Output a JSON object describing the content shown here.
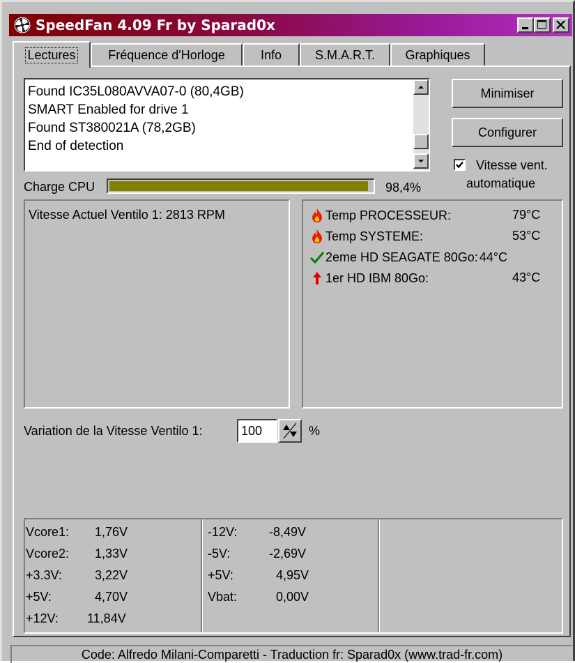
{
  "window": {
    "title": "SpeedFan 4.09 Fr by Sparad0x",
    "minimize_icon": "minimize-icon",
    "maximize_icon": "maximize-icon",
    "close_icon": "close-icon"
  },
  "tabs": [
    {
      "label": "Lectures",
      "active": true
    },
    {
      "label": "Fréquence d'Horloge"
    },
    {
      "label": "Info"
    },
    {
      "label": "S.M.A.R.T."
    },
    {
      "label": "Graphiques"
    }
  ],
  "log": {
    "lines": [
      "Found IC35L080AVVA07-0 (80,4GB)",
      "SMART Enabled for drive 1",
      "Found ST380021A (78,2GB)",
      "End of detection"
    ]
  },
  "buttons": {
    "minimize": "Minimiser",
    "configure": "Configurer"
  },
  "auto_fan": {
    "label_line1": "Vitesse vent.",
    "label_line2": "automatique",
    "checked": true
  },
  "cpu": {
    "label": "Charge CPU",
    "percent_text": "98,4%",
    "load_fraction": 0.984,
    "bar_color": "#808000"
  },
  "fans": {
    "lines": [
      "Vitesse Actuel Ventilo 1: 2813 RPM"
    ]
  },
  "temps": [
    {
      "icon": "flame-icon",
      "label": "Temp PROCESSEUR:",
      "value": "79°C"
    },
    {
      "icon": "flame-icon",
      "label": "Temp SYSTEME:",
      "value": "53°C"
    },
    {
      "icon": "checkmark-icon",
      "label": "2eme HD SEAGATE 80Go:",
      "value": "44°C"
    },
    {
      "icon": "arrow-up-icon",
      "label": "1er HD IBM 80Go:",
      "value": "43°C"
    }
  ],
  "fan_variation": {
    "label": "Variation de la Vitesse Ventilo 1:",
    "value": "100",
    "unit": "%"
  },
  "voltages": {
    "col1": [
      {
        "label": "Vcore1:",
        "value": "1,76V"
      },
      {
        "label": "Vcore2:",
        "value": "1,33V"
      },
      {
        "label": "+3.3V:",
        "value": "3,22V"
      },
      {
        "label": "+5V:",
        "value": "4,70V"
      },
      {
        "label": "+12V:",
        "value": "11,84V"
      }
    ],
    "col2": [
      {
        "label": "-12V:",
        "value": "-8,49V"
      },
      {
        "label": "-5V:",
        "value": "-2,69V"
      },
      {
        "label": "+5V:",
        "value": "4,95V"
      },
      {
        "label": "Vbat:",
        "value": "0,00V"
      }
    ]
  },
  "status": {
    "text": "Code: Alfredo Milani-Comparetti - Traduction fr: Sparad0x (www.trad-fr.com)"
  }
}
